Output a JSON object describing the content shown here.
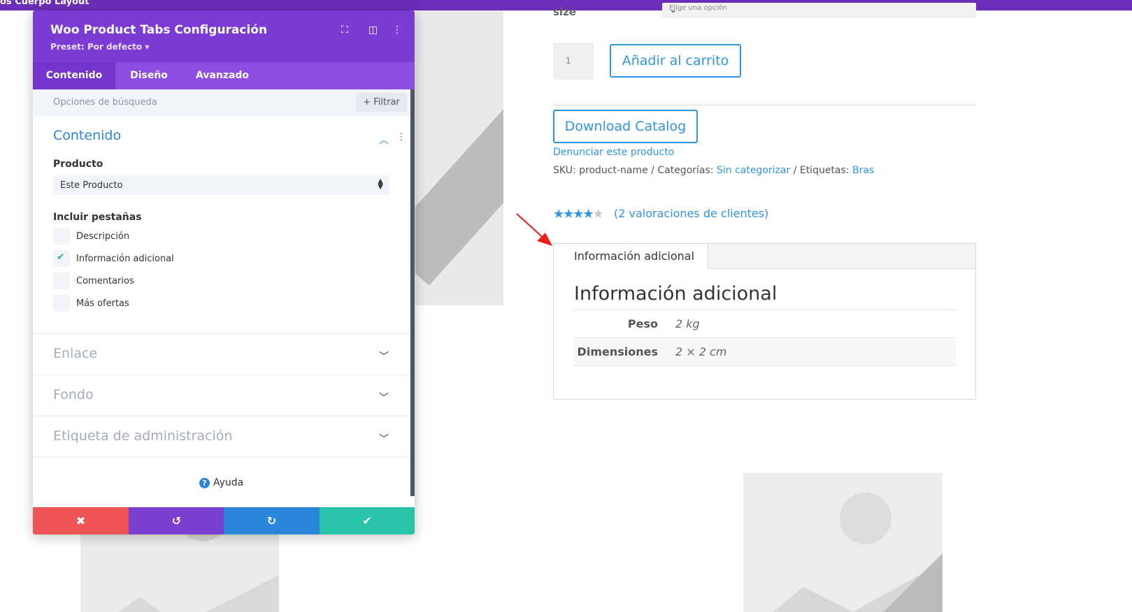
{
  "top_bar": {
    "label": "os Cuerpo Layout"
  },
  "panel": {
    "title": "Woo Product Tabs Configuración",
    "preset": "Preset: Por defecto",
    "preset_caret": "▾",
    "header_icons": [
      "expand-icon",
      "columns-icon",
      "more-vertical-icon"
    ],
    "tabs": [
      {
        "label": "Contenido",
        "active": true
      },
      {
        "label": "Diseño",
        "active": false
      },
      {
        "label": "Avanzado",
        "active": false
      }
    ],
    "search_placeholder": "Opciones de búsqueda",
    "filter_label": "Filtrar",
    "filter_icon": "+",
    "sections": {
      "content": {
        "title": "Contenido",
        "product_label": "Producto",
        "product_value": "Este Producto",
        "include_tabs_label": "Incluir pestañas",
        "checkboxes": [
          {
            "label": "Descripción",
            "checked": false
          },
          {
            "label": "Información adicional",
            "checked": true
          },
          {
            "label": "Comentarios",
            "checked": false
          },
          {
            "label": "Más ofertas",
            "checked": false
          }
        ]
      },
      "collapsed": [
        {
          "title": "Enlace"
        },
        {
          "title": "Fondo"
        },
        {
          "title": "Etiqueta de administración"
        }
      ]
    },
    "help_label": "Ayuda",
    "footer_colors": {
      "cancel": "#ef5555",
      "undo": "#7b3fd0",
      "redo": "#2b87da",
      "save": "#29c4a9"
    }
  },
  "product": {
    "size_label": "size",
    "size_placeholder": "Elige una opción",
    "quantity": "1",
    "add_to_cart": "Añadir al carrito",
    "download_catalog": "Download Catalog",
    "report_link": "Denunciar este producto",
    "meta": {
      "sku_label": "SKU:",
      "sku_value": "product-name",
      "categories_label": "Categorías:",
      "categories_value": "Sin categorizar",
      "tags_label": "Etiquetas:",
      "tags_value": "Bras"
    },
    "rating": {
      "stars_filled": 4,
      "stars_total": 5,
      "reviews_text": "(2 valoraciones de clientes)"
    },
    "tabs_widget": {
      "active_tab": "Información adicional",
      "heading": "Información adicional",
      "attributes": [
        {
          "name": "Peso",
          "value": "2 kg"
        },
        {
          "name": "Dimensiones",
          "value": "2 × 2 cm"
        }
      ]
    }
  },
  "colors": {
    "accent_purple": "#7c3bd4",
    "link_blue": "#2e96e2",
    "arrow_red": "#f21b1b"
  }
}
